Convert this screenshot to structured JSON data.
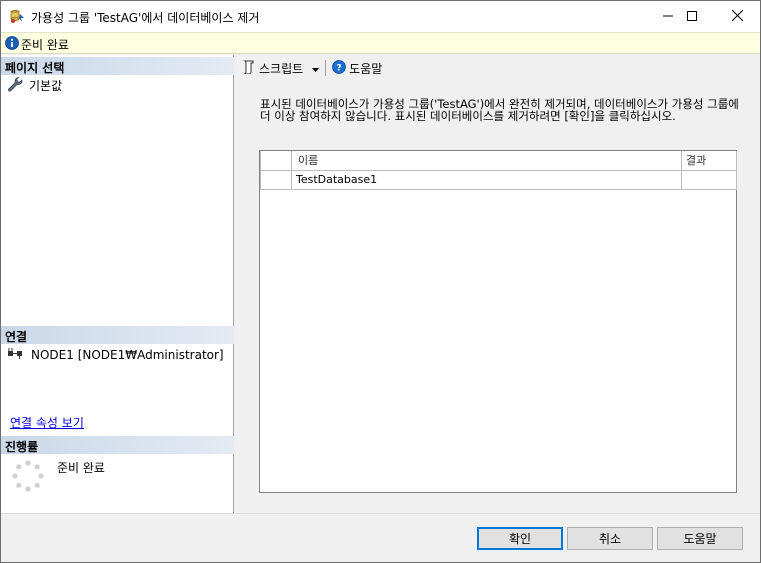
{
  "window": {
    "title": "가용성 그룹 'TestAG'에서 데이터베이스 제거",
    "title_icon": "sql-database-wizard-icon",
    "controls": [
      "minimize-icon",
      "maximize-icon",
      "close-icon"
    ]
  },
  "status": {
    "icon": "info-icon",
    "text": "준비 완료"
  },
  "left": {
    "page_select_header": "페이지 선택",
    "pages": [
      {
        "label": "기본값",
        "icon": "wrench-icon"
      }
    ],
    "connection_header": "연결",
    "connection": {
      "icon": "connection-plug-icon",
      "text": "NODE1 [NODE1₩Administrator]"
    },
    "connection_link": "연결 속성 보기",
    "progress_header": "진행률",
    "progress": {
      "icon": "progress-spinner-icon",
      "text": "준비 완료"
    }
  },
  "toolbar": {
    "script_label": "스크립트",
    "help_label": "도움말"
  },
  "main": {
    "description": "표시된 데이터베이스가 가용성 그룹('TestAG')에서 완전히 제거되며, 데이터베이스가 가용성 그룹에 더 이상 참여하지 않습니다. 표시된 데이터베이스를 제거하려면 [확인]을 클릭하십시오.",
    "columns": [
      "",
      "이름",
      "결과"
    ],
    "rows": [
      [
        "",
        "TestDatabase1",
        ""
      ]
    ]
  },
  "buttons": {
    "ok": "확인",
    "cancel": "취소",
    "help": "도움말"
  },
  "colors": {
    "status_bg": "#ffffe1",
    "section_header": "#c9d8e8",
    "default_button_border": "#0078d7",
    "link": "#0000ee"
  }
}
